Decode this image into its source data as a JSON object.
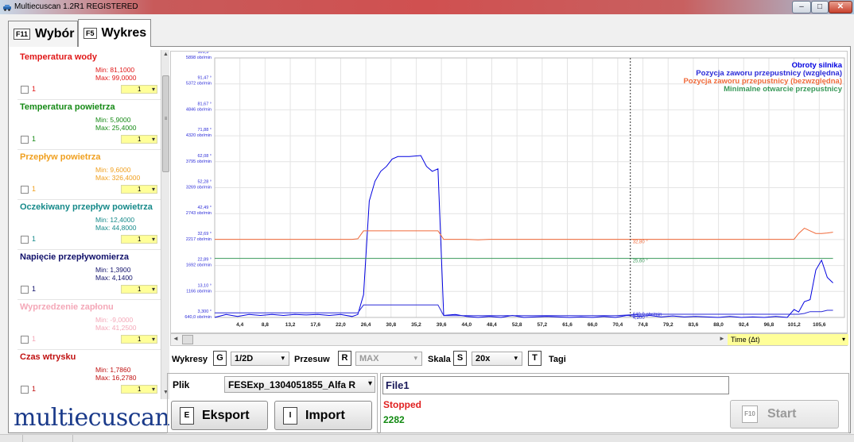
{
  "window": {
    "title": "Multiecuscan 1.2R1 REGISTERED",
    "min_glyph": "–",
    "max_glyph": "□",
    "close_glyph": "✕",
    "icon": "car-icon"
  },
  "tabs": [
    {
      "key": "F11",
      "label": "Wybór"
    },
    {
      "key": "F5",
      "label": "Wykres"
    }
  ],
  "sensors": [
    {
      "name": "Temperatura wody",
      "min": "Min: 81,1000",
      "max": "Max: 99,0000",
      "num": "1",
      "sel": "1",
      "color": "#e01818"
    },
    {
      "name": "Temperatura powietrza",
      "min": "Min: 5,9000",
      "max": "Max: 25,4000",
      "num": "1",
      "sel": "1",
      "color": "#168a16"
    },
    {
      "name": "Przepływ powietrza",
      "min": "Min: 9,6000",
      "max": "Max: 326,4000",
      "num": "1",
      "sel": "1",
      "color": "#f0a020"
    },
    {
      "name": "Oczekiwany przepływ powietrza",
      "min": "Min: 12,4000",
      "max": "Max: 44,8000",
      "num": "1",
      "sel": "1",
      "color": "#168a8a"
    },
    {
      "name": "Napięcie przepływomierza",
      "min": "Min: 1,3900",
      "max": "Max: 4,1400",
      "num": "1",
      "sel": "1",
      "color": "#10106a"
    },
    {
      "name": "Wyprzedzenie zapłonu",
      "min": "Min: -9,0000",
      "max": "Max: 41,2500",
      "num": "1",
      "sel": "1",
      "color": "#f4a8b8"
    },
    {
      "name": "Czas wtrysku",
      "min": "Min: 1,7860",
      "max": "Max: 16,2780",
      "num": "1",
      "sel": "1",
      "color": "#c01010"
    }
  ],
  "logo": "multiecuscan",
  "chart_data": {
    "type": "line",
    "x_ticks": [
      "4,4",
      "8,8",
      "13,2",
      "17,6",
      "22,0",
      "26,4",
      "30,8",
      "35,2",
      "39,6",
      "44,0",
      "48,4",
      "52,8",
      "57,2",
      "61,6",
      "66,0",
      "70,4",
      "74,8",
      "79,2",
      "83,6",
      "88,0",
      "92,4",
      "96,8",
      "101,2",
      "105,6"
    ],
    "xlim": [
      0,
      110
    ],
    "y_ticks": [
      {
        "deg": "3,300 °",
        "rpm": "640,0 obr/min"
      },
      {
        "deg": "13,10 °",
        "rpm": "1166 obr/min"
      },
      {
        "deg": "22,89 °",
        "rpm": "1692 obr/min"
      },
      {
        "deg": "32,69 °",
        "rpm": "2217 obr/min"
      },
      {
        "deg": "42,49 °",
        "rpm": "2743 obr/min"
      },
      {
        "deg": "52,28 °",
        "rpm": "3269 obr/min"
      },
      {
        "deg": "62,08 °",
        "rpm": "3795 obr/min"
      },
      {
        "deg": "71,88 °",
        "rpm": "4320 obr/min"
      },
      {
        "deg": "81,67 °",
        "rpm": "4846 obr/min"
      },
      {
        "deg": "91,47 °",
        "rpm": "5372 obr/min"
      },
      {
        "deg": "101,3 °",
        "rpm": "5898 obr/min"
      }
    ],
    "ylim_deg": [
      3.3,
      101.3
    ],
    "ylim_rpm": [
      640,
      5898
    ],
    "legend_position": "top-right",
    "grid": true,
    "cursor_x": 72.6,
    "cursor_labels": [
      {
        "text": "32,80 °",
        "color": "#f06a3a",
        "y_deg": 32.8
      },
      {
        "text": "25,60 °",
        "color": "#3a9a5a",
        "y_deg": 25.6
      },
      {
        "text": "640,0 obr/min",
        "color": "#2a2ad8",
        "y_rpm": 640
      },
      {
        "text": "4,200 °",
        "color": "#2a2ad8",
        "y_deg": 4.2
      }
    ],
    "series": [
      {
        "name": "Obroty silnika",
        "color": "#0000e0",
        "unit": "rpm",
        "x": [
          0,
          2,
          4,
          6,
          8,
          10,
          12,
          14,
          16,
          18,
          20,
          22,
          24,
          25,
          26,
          27,
          28,
          29,
          30,
          31,
          32,
          33,
          34,
          36,
          37,
          38,
          39,
          40,
          42,
          44,
          46,
          48,
          50,
          52,
          54,
          56,
          58,
          60,
          62,
          64,
          66,
          68,
          70,
          72,
          74,
          76,
          78,
          80,
          82,
          84,
          86,
          88,
          90,
          92,
          94,
          96,
          98,
          100,
          101.2,
          102,
          103,
          104,
          105,
          106,
          107,
          108
        ],
        "y": [
          640,
          700,
          660,
          700,
          680,
          700,
          680,
          700,
          690,
          700,
          680,
          700,
          660,
          700,
          1100,
          3000,
          3400,
          3600,
          3700,
          3850,
          3900,
          3900,
          3900,
          3920,
          3700,
          3600,
          3650,
          680,
          700,
          660,
          640,
          660,
          640,
          680,
          640,
          650,
          660,
          650,
          640,
          650,
          640,
          660,
          640,
          680,
          660,
          680,
          650,
          670,
          650,
          660,
          650,
          640,
          660,
          640,
          650,
          640,
          660,
          640,
          800,
          750,
          960,
          1000,
          1600,
          1800,
          1450,
          1340
        ]
      },
      {
        "name": "Pozycja zaworu przepustnicy (względna)",
        "color": "#2a2ad8",
        "unit": "deg",
        "x": [
          0,
          2,
          4,
          6,
          8,
          10,
          12,
          14,
          16,
          18,
          20,
          22,
          24,
          25,
          26,
          27,
          28,
          30,
          32,
          34,
          36,
          38,
          39,
          40,
          42,
          44,
          46,
          48,
          50,
          52,
          54,
          56,
          58,
          60,
          62,
          64,
          66,
          68,
          70,
          72,
          74,
          76,
          78,
          80,
          82,
          84,
          86,
          88,
          90,
          92,
          94,
          96,
          98,
          100,
          101.2,
          102,
          103,
          104,
          105,
          106,
          107,
          108
        ],
        "y": [
          5,
          5,
          5,
          5,
          5,
          5,
          5,
          5,
          5,
          5,
          5,
          5,
          5,
          5,
          8,
          8,
          8,
          8,
          8,
          8,
          8,
          8,
          8,
          4,
          4,
          4,
          4,
          4,
          4,
          4,
          4,
          4,
          4,
          4,
          4,
          4,
          4,
          4,
          4,
          4.2,
          4.5,
          4.5,
          4.5,
          4.5,
          4.5,
          4.5,
          4.5,
          4.5,
          4.5,
          4.5,
          4.5,
          4.5,
          4.5,
          4.5,
          4.5,
          4.5,
          4.8,
          5.5,
          5.5,
          5.5,
          6,
          6
        ]
      },
      {
        "name": "Pozycja zaworu przepustnicy (bezwzględna)",
        "color": "#f06a3a",
        "unit": "deg",
        "x": [
          0,
          4,
          8,
          12,
          16,
          20,
          24,
          25,
          26,
          27,
          28,
          30,
          32,
          34,
          36,
          38,
          39,
          40,
          42,
          44,
          46,
          48,
          50,
          52,
          54,
          56,
          58,
          60,
          62,
          64,
          66,
          68,
          70,
          72,
          74,
          76,
          78,
          80,
          82,
          84,
          86,
          88,
          90,
          92,
          94,
          96,
          98,
          100,
          101.2,
          102,
          103,
          104,
          105,
          106,
          107,
          108
        ],
        "y": [
          32.8,
          32.8,
          32.8,
          32.8,
          32.8,
          32.8,
          32.8,
          33,
          36,
          36,
          36,
          36,
          36,
          36,
          36,
          36,
          36,
          32.8,
          32.8,
          32.8,
          32.6,
          32.8,
          32.8,
          32.8,
          32.8,
          32.8,
          32.8,
          32.8,
          32.8,
          32.8,
          32.8,
          32.8,
          32.8,
          32.8,
          32.8,
          32.8,
          32.8,
          32.8,
          32.8,
          32.8,
          32.8,
          32.8,
          32.8,
          32.8,
          32.8,
          32.8,
          32.8,
          32.8,
          32.8,
          35,
          37,
          36,
          35,
          35,
          35.2,
          35.5
        ]
      },
      {
        "name": "Minimalne otwarcie przepustnicy",
        "color": "#3a9a5a",
        "unit": "deg",
        "x": [
          0,
          108
        ],
        "y": [
          25.6,
          25.6
        ]
      }
    ]
  },
  "timeline": {
    "left_arrow": "◄",
    "right_arrow": "►",
    "time_label": "Time (Δt)",
    "dropdown_arrow": "▾"
  },
  "controls": {
    "wykresy_label": "Wykresy",
    "wykresy_key": "G",
    "wykresy_value": "1/2D",
    "przesuw_label": "Przesuw",
    "przesuw_key": "R",
    "przesuw_value": "MAX",
    "skala_label": "Skala",
    "skala_key": "S",
    "skala_value": "20x",
    "tagi_key": "T",
    "tagi_label": "Tagi"
  },
  "plik": {
    "label": "Plik",
    "value": "FESExp_1304051855_Alfa R",
    "eksport_key": "E",
    "eksport_label": "Eksport",
    "import_key": "I",
    "import_label": "Import"
  },
  "file": {
    "name": "File1",
    "status": "Stopped",
    "count": "2282",
    "start_key": "F10",
    "start_label": "Start"
  }
}
